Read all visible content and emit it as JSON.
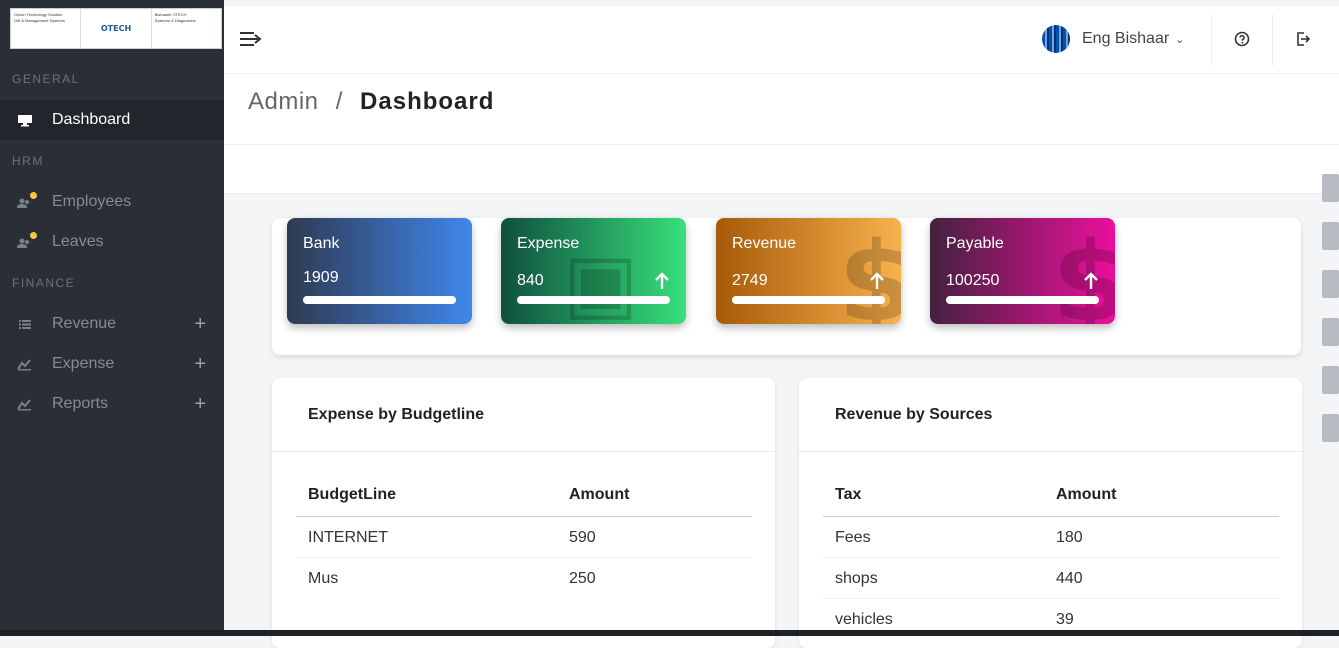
{
  "logo": {
    "left_line1": "Ozzun Technology Solution",
    "left_line2": "Gift & Management Systems",
    "brand": "OTECH",
    "right_line1": "Bishaarle OTECH",
    "right_line2": "Systems & Diagnostics"
  },
  "sidebar": {
    "sections": [
      "GENERAL",
      "HRM",
      "FINANCE"
    ],
    "items": [
      {
        "label": "Dashboard",
        "icon": "monitor-icon"
      },
      {
        "label": "Employees",
        "icon": "users-icon"
      },
      {
        "label": "Leaves",
        "icon": "users-icon"
      },
      {
        "label": "Revenue",
        "icon": "list-icon",
        "expand": "+"
      },
      {
        "label": "Expense",
        "icon": "chart-icon",
        "expand": "+"
      },
      {
        "label": "Reports",
        "icon": "chart-icon",
        "expand": "+"
      }
    ]
  },
  "topbar": {
    "user_name": "Eng Bishaar",
    "caret": "⌄"
  },
  "breadcrumb": {
    "parent": "Admin",
    "separator": "/",
    "current": "Dashboard"
  },
  "stats": [
    {
      "title": "Bank",
      "value": "1909",
      "bar_fraction": 1.0,
      "color_start": "#2f3a52",
      "color_end": "#3f87ec"
    },
    {
      "title": "Expense",
      "value": "840",
      "bar_fraction": 1.0,
      "color_start": "#0f4f3f",
      "color_end": "#37e07a"
    },
    {
      "title": "Revenue",
      "value": "2749",
      "bar_fraction": 1.0,
      "color_start": "#a75a08",
      "color_end": "#f7b24e"
    },
    {
      "title": "Payable",
      "value": "100250",
      "bar_fraction": 1.0,
      "color_start": "#44213f",
      "color_end": "#ec0f9c"
    }
  ],
  "expense_panel": {
    "title": "Expense by Budgetline",
    "columns": [
      "BudgetLine",
      "Amount"
    ],
    "rows": [
      [
        "INTERNET",
        "590"
      ],
      [
        "Mus",
        "250"
      ]
    ]
  },
  "revenue_panel": {
    "title": "Revenue by Sources",
    "columns": [
      "Tax",
      "Amount"
    ],
    "rows": [
      [
        "Fees",
        "180"
      ],
      [
        "shops",
        "440"
      ],
      [
        "vehicles",
        "39"
      ]
    ]
  }
}
